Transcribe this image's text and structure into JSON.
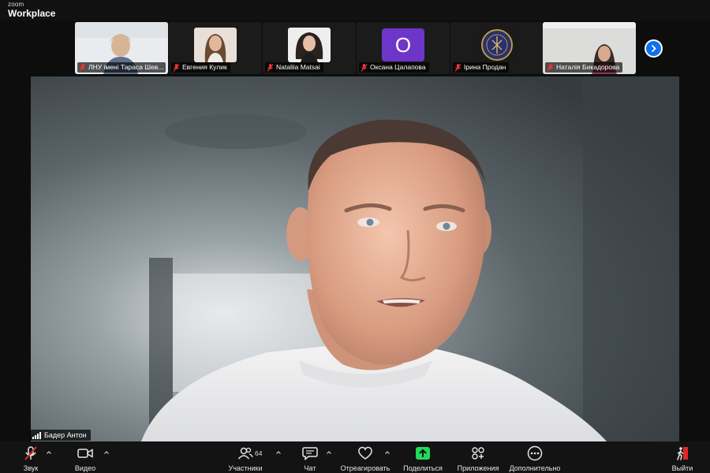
{
  "brand": {
    "small": "zoom",
    "name": "Workplace"
  },
  "participants_strip": [
    {
      "name": "ЛНУ імені Тараса Шев..."
    },
    {
      "name": "Евгения Кулик"
    },
    {
      "name": "Nataliia Matsai"
    },
    {
      "name": "Оксана Цалапова",
      "initial": "O"
    },
    {
      "name": "Ірина Продан"
    },
    {
      "name": "Наталія Бикадорова"
    }
  ],
  "speaker": {
    "name": "Бадер Антон"
  },
  "toolbar": {
    "audio": "Звук",
    "video": "Видео",
    "participants": "Участники",
    "participants_count": "64",
    "chat": "Чат",
    "react": "Отреагировать",
    "share": "Поделиться",
    "apps": "Приложения",
    "more": "Дополнительно",
    "leave": "Выйти"
  },
  "colors": {
    "accent": "#0e72ed",
    "share_green": "#23d959",
    "leave_red": "#e02828",
    "avatar_purple": "#6e35c9"
  }
}
